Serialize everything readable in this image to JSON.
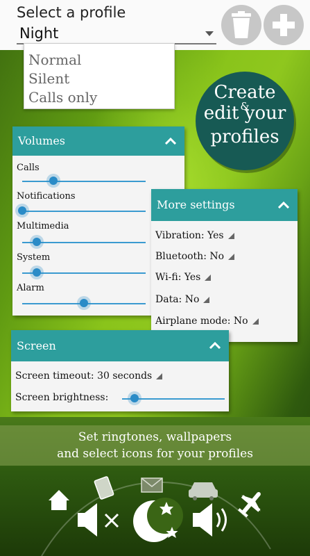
{
  "profile": {
    "title": "Select a profile",
    "selected": "Night",
    "options": [
      "Normal",
      "Silent",
      "Calls only"
    ]
  },
  "toolbar": {
    "delete_icon": "trash-icon",
    "add_icon": "plus-icon"
  },
  "promo": {
    "line1": "Create",
    "amp": "&",
    "line2": "edit your",
    "line3": "profiles"
  },
  "volumes": {
    "title": "Volumes",
    "items": [
      {
        "label": "Calls",
        "level": 0.25
      },
      {
        "label": "Notifications",
        "level": 0.0
      },
      {
        "label": "Multimedia",
        "level": 0.12
      },
      {
        "label": "System",
        "level": 0.12
      },
      {
        "label": "Alarm",
        "level": 0.5
      }
    ]
  },
  "more_settings": {
    "title": "More settings",
    "items": [
      "Vibration: Yes",
      "Bluetooth: No",
      "Wi-fi: Yes",
      "Data: No",
      "Airplane mode: No"
    ]
  },
  "screen": {
    "title": "Screen",
    "timeout": "Screen timeout: 30 seconds",
    "brightness_label": "Screen brightness:",
    "brightness_level": 0.08
  },
  "ribbon": {
    "line1": "Set ringtones, wallpapers",
    "line2": "and select icons for your profiles"
  },
  "icons": [
    "home-icon",
    "phone-icon",
    "mail-icon",
    "car-icon",
    "airplane-icon",
    "speaker-muted-icon",
    "moon-stars-icon",
    "speaker-loud-icon"
  ],
  "colors": {
    "accent": "#2d9e9d",
    "slider": "#2a8bc7",
    "promo": "#175a54"
  }
}
